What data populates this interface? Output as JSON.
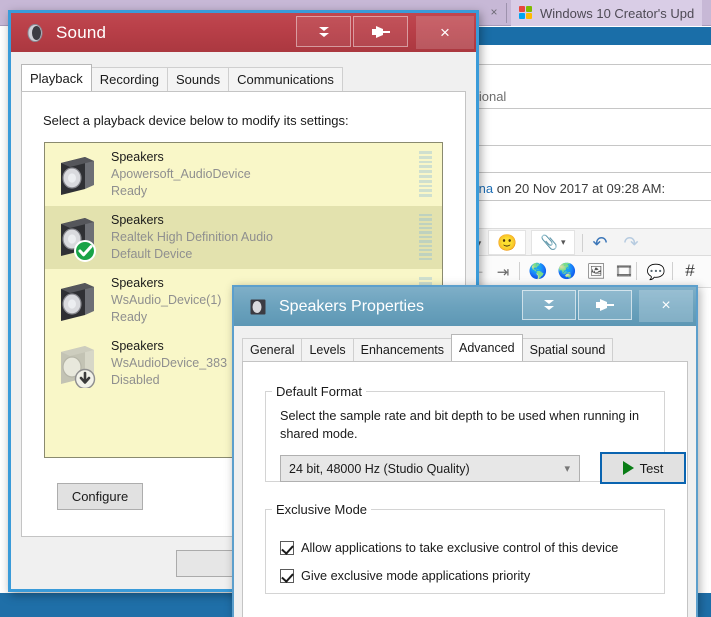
{
  "background": {
    "tab_close_label": "×",
    "tab_title": "Windows 10 Creator's Upd",
    "text_optional": "ptional",
    "text_author": "china",
    "text_rest": " on 20 Nov 2017 at 09:28 AM:"
  },
  "sound_window": {
    "title": "Sound",
    "icon": "speaker-icon",
    "close_label": "×",
    "buttons": {
      "rollup": "rollup-icon",
      "pin": "pin-icon"
    },
    "tabs": [
      {
        "label": "Playback",
        "active": true
      },
      {
        "label": "Recording",
        "active": false
      },
      {
        "label": "Sounds",
        "active": false
      },
      {
        "label": "Communications",
        "active": false
      }
    ],
    "panel_label": "Select a playback device below to modify its settings:",
    "devices": [
      {
        "name": "Speakers",
        "description": "Apowersoft_AudioDevice",
        "status": "Ready",
        "selected": false,
        "badge": "none",
        "meter_segments": 10,
        "meter_active": false
      },
      {
        "name": "Speakers",
        "description": "Realtek High Definition Audio",
        "status": "Default Device",
        "selected": true,
        "badge": "check-icon",
        "meter_segments": 11,
        "meter_active": true
      },
      {
        "name": "Speakers",
        "description": "WsAudio_Device(1)",
        "status": "Ready",
        "selected": false,
        "badge": "none",
        "meter_segments": 10,
        "meter_active": false
      },
      {
        "name": "Speakers",
        "description": "WsAudioDevice_383",
        "status": "Disabled",
        "selected": false,
        "badge": "down-arrow-icon",
        "meter_segments": 0,
        "meter_active": false
      }
    ],
    "configure_label": "Configure"
  },
  "properties_window": {
    "title": "Speakers Properties",
    "icon": "speaker-icon",
    "close_label": "×",
    "buttons": {
      "rollup": "rollup-icon",
      "pin": "pin-icon"
    },
    "tabs": [
      {
        "label": "General",
        "active": false
      },
      {
        "label": "Levels",
        "active": false
      },
      {
        "label": "Enhancements",
        "active": false
      },
      {
        "label": "Advanced",
        "active": true
      },
      {
        "label": "Spatial sound",
        "active": false
      }
    ],
    "default_format": {
      "legend": "Default Format",
      "description": "Select the sample rate and bit depth to be used when running in shared mode.",
      "selected_option": "24 bit, 48000 Hz (Studio Quality)",
      "chevron": "chevron-down-icon",
      "test_label": "Test",
      "test_icon": "play-icon"
    },
    "exclusive_mode": {
      "legend": "Exclusive Mode",
      "checkboxes": [
        {
          "label": "Allow applications to take exclusive control of this device",
          "checked": true
        },
        {
          "label": "Give exclusive mode applications priority",
          "checked": true
        }
      ]
    }
  },
  "colors": {
    "sound_titlebar": "#b83f48",
    "sound_border": "#3a9bd9",
    "props_titlebar": "#6ba2bd",
    "props_border": "#5c9fcc",
    "list_background": "#f9f7c8",
    "list_selected": "#e3e2ae",
    "accent_blue": "#0a64b0",
    "play_green": "#0a7d16",
    "taskbar": "#1f6fa8"
  }
}
